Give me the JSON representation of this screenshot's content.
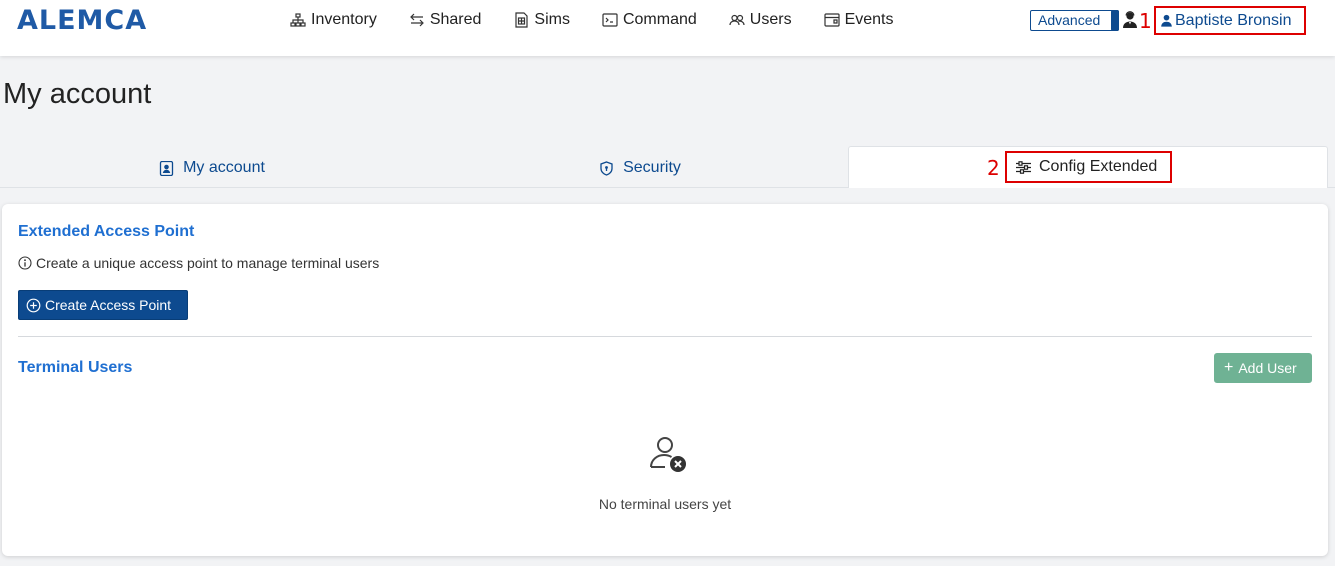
{
  "header": {
    "logo": "ALEMCA",
    "nav": [
      {
        "label": "Inventory",
        "icon": "sitemap-icon"
      },
      {
        "label": "Shared",
        "icon": "swap-arrows-icon"
      },
      {
        "label": "Sims",
        "icon": "sim-card-icon"
      },
      {
        "label": "Command",
        "icon": "terminal-icon"
      },
      {
        "label": "Users",
        "icon": "users-icon"
      },
      {
        "label": "Events",
        "icon": "calendar-icon"
      }
    ],
    "advanced_label": "Advanced",
    "marker_1": "1",
    "user_name": "Baptiste Bronsin"
  },
  "page": {
    "title": "My account"
  },
  "tabs": {
    "my_account": "My account",
    "security": "Security",
    "config_extended": "Config Extended",
    "marker_2": "2"
  },
  "extended_access_point": {
    "title": "Extended Access Point",
    "info": "Create a unique access point to manage terminal users",
    "create_button": "Create Access Point"
  },
  "terminal_users": {
    "title": "Terminal Users",
    "add_button": "Add User",
    "empty_text": "No terminal users yet"
  },
  "colors": {
    "primary": "#0d4a8f",
    "link": "#1f6fd1",
    "success_button": "#6fb294",
    "highlight": "#dd0000"
  }
}
